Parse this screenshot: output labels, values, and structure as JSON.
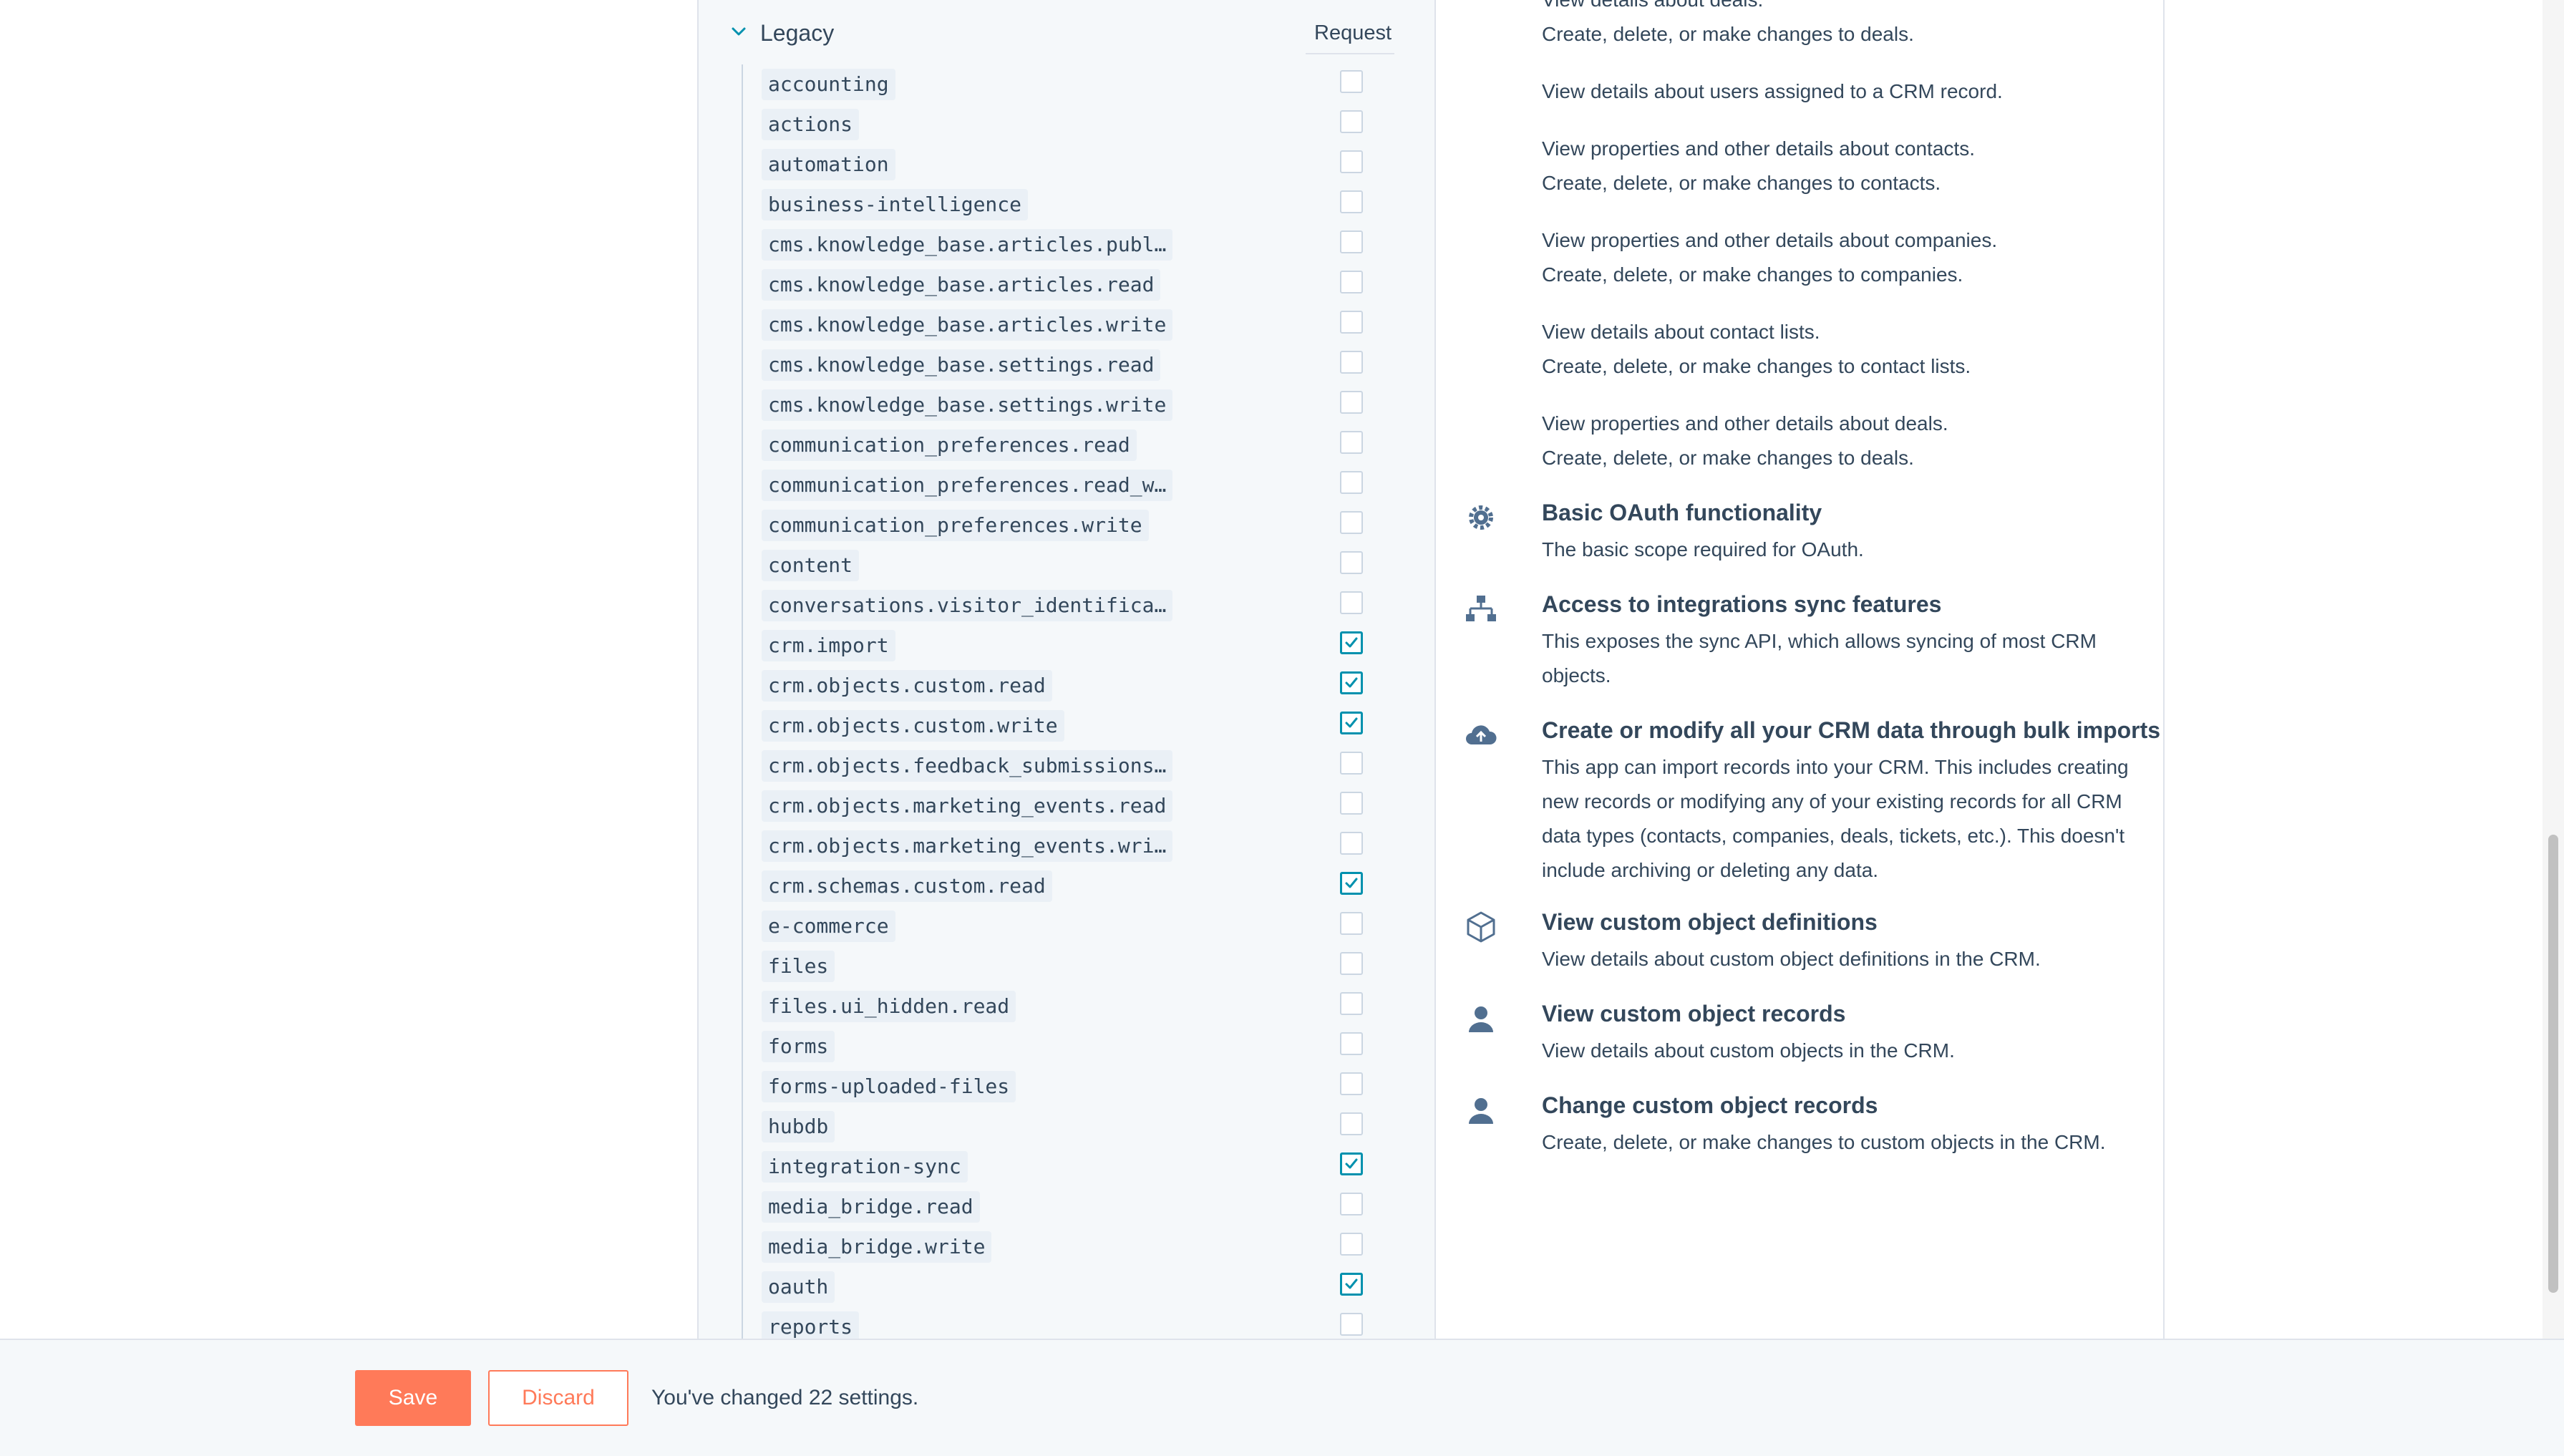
{
  "colors": {
    "accent": "#ff7a59",
    "check": "#0091ae",
    "text": "#33475b",
    "panel_bg": "#f5f8fa"
  },
  "legacy": {
    "title": "Legacy",
    "request_header": "Request",
    "expanded": true
  },
  "scopes": [
    {
      "name": "accounting",
      "checked": false
    },
    {
      "name": "actions",
      "checked": false
    },
    {
      "name": "automation",
      "checked": false
    },
    {
      "name": "business-intelligence",
      "checked": false
    },
    {
      "name": "cms.knowledge_base.articles.publ…",
      "checked": false
    },
    {
      "name": "cms.knowledge_base.articles.read",
      "checked": false
    },
    {
      "name": "cms.knowledge_base.articles.write",
      "checked": false
    },
    {
      "name": "cms.knowledge_base.settings.read",
      "checked": false
    },
    {
      "name": "cms.knowledge_base.settings.write",
      "checked": false
    },
    {
      "name": "communication_preferences.read",
      "checked": false
    },
    {
      "name": "communication_preferences.read_w…",
      "checked": false
    },
    {
      "name": "communication_preferences.write",
      "checked": false
    },
    {
      "name": "content",
      "checked": false
    },
    {
      "name": "conversations.visitor_identifica…",
      "checked": false
    },
    {
      "name": "crm.import",
      "checked": true
    },
    {
      "name": "crm.objects.custom.read",
      "checked": true
    },
    {
      "name": "crm.objects.custom.write",
      "checked": true
    },
    {
      "name": "crm.objects.feedback_submissions…",
      "checked": false
    },
    {
      "name": "crm.objects.marketing_events.read",
      "checked": false
    },
    {
      "name": "crm.objects.marketing_events.wri…",
      "checked": false
    },
    {
      "name": "crm.schemas.custom.read",
      "checked": true
    },
    {
      "name": "e-commerce",
      "checked": false
    },
    {
      "name": "files",
      "checked": false
    },
    {
      "name": "files.ui_hidden.read",
      "checked": false
    },
    {
      "name": "forms",
      "checked": false
    },
    {
      "name": "forms-uploaded-files",
      "checked": false
    },
    {
      "name": "hubdb",
      "checked": false
    },
    {
      "name": "integration-sync",
      "checked": true
    },
    {
      "name": "media_bridge.read",
      "checked": false
    },
    {
      "name": "media_bridge.write",
      "checked": false
    },
    {
      "name": "oauth",
      "checked": true
    },
    {
      "name": "reports",
      "checked": false
    }
  ],
  "descriptions": [
    "View details about deals.",
    "Create, delete, or make changes to deals.",
    "View details about users assigned to a CRM record.",
    "View properties and other details about contacts.",
    "Create, delete, or make changes to contacts.",
    "View properties and other details about companies.",
    "Create, delete, or make changes to companies.",
    "View details about contact lists.",
    "Create, delete, or make changes to contact lists.",
    "View properties and other details about deals.",
    "Create, delete, or make changes to deals."
  ],
  "permissions": [
    {
      "icon": "gear-icon",
      "title": "Basic OAuth functionality",
      "desc": "The basic scope required for OAuth."
    },
    {
      "icon": "sync-network-icon",
      "title": "Access to integrations sync features",
      "desc": "This exposes the sync API, which allows syncing of most CRM objects."
    },
    {
      "icon": "cloud-upload-icon",
      "title": "Create or modify all your CRM data through bulk imports",
      "desc": "This app can import records into your CRM. This includes creating new records or modifying any of your existing records for all CRM data types (contacts, companies, deals, tickets, etc.). This doesn't include archiving or deleting any data."
    },
    {
      "icon": "cube-icon",
      "title": "View custom object definitions",
      "desc": "View details about custom object definitions in the CRM."
    },
    {
      "icon": "person-icon",
      "title": "View custom object records",
      "desc": "View details about custom objects in the CRM."
    },
    {
      "icon": "person-icon",
      "title": "Change custom object records",
      "desc": "Create, delete, or make changes to custom objects in the CRM."
    }
  ],
  "footer": {
    "save_label": "Save",
    "discard_label": "Discard",
    "status": "You've changed 22 settings."
  }
}
